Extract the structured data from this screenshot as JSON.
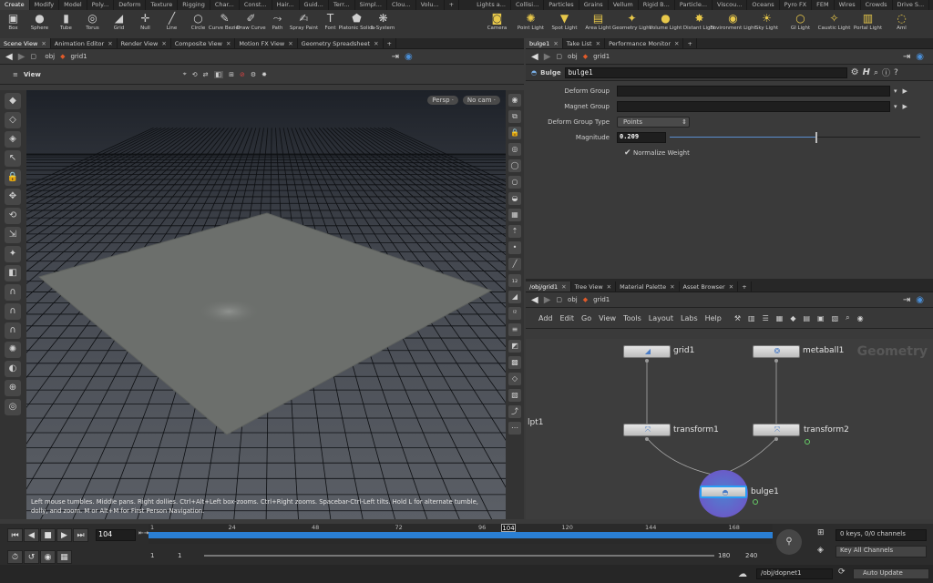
{
  "shelf": {
    "tabs_left": [
      "Create",
      "Modify",
      "Model",
      "Poly...",
      "Deform",
      "Texture",
      "Rigging",
      "Char...",
      "Const...",
      "Hair...",
      "Guid...",
      "Terr...",
      "Simpl...",
      "Clou...",
      "Volu..."
    ],
    "tabs_right": [
      "Lights a...",
      "Collisi...",
      "Particles",
      "Grains",
      "Vellum",
      "Rigid B...",
      "Particle...",
      "Viscou...",
      "Oceans",
      "Pyro FX",
      "FEM",
      "Wires",
      "Crowds",
      "Drive S..."
    ],
    "tools_left": [
      {
        "icon": "box-icon",
        "glyph": "▣",
        "label": "Box"
      },
      {
        "icon": "sphere-icon",
        "glyph": "●",
        "label": "Sphere"
      },
      {
        "icon": "tube-icon",
        "glyph": "▮",
        "label": "Tube"
      },
      {
        "icon": "torus-icon",
        "glyph": "◎",
        "label": "Torus"
      },
      {
        "icon": "grid-icon",
        "glyph": "◢",
        "label": "Grid"
      },
      {
        "icon": "null-icon",
        "glyph": "✛",
        "label": "Null"
      },
      {
        "icon": "line-icon",
        "glyph": "╱",
        "label": "Line"
      },
      {
        "icon": "circle-icon",
        "glyph": "○",
        "label": "Circle"
      },
      {
        "icon": "curve-bezier-icon",
        "glyph": "✎",
        "label": "Curve Bezier"
      },
      {
        "icon": "draw-curve-icon",
        "glyph": "✐",
        "label": "Draw Curve"
      },
      {
        "icon": "path-icon",
        "glyph": "⤳",
        "label": "Path"
      },
      {
        "icon": "spray-paint-icon",
        "glyph": "✍",
        "label": "Spray Paint"
      },
      {
        "icon": "font-icon",
        "glyph": "T",
        "label": "Font"
      },
      {
        "icon": "platonic-solids-icon",
        "glyph": "⬟",
        "label": "Platonic Solids"
      },
      {
        "icon": "l-system-icon",
        "glyph": "❋",
        "label": "L-System"
      }
    ],
    "tools_right": [
      {
        "icon": "camera-icon",
        "glyph": "◙",
        "label": "Camera"
      },
      {
        "icon": "point-light-icon",
        "glyph": "✺",
        "label": "Point Light"
      },
      {
        "icon": "spot-light-icon",
        "glyph": "▼",
        "label": "Spot Light"
      },
      {
        "icon": "area-light-icon",
        "glyph": "▤",
        "label": "Area Light"
      },
      {
        "icon": "geometry-light-icon",
        "glyph": "✦",
        "label": "Geometry Light"
      },
      {
        "icon": "volume-light-icon",
        "glyph": "●",
        "label": "Volume Light"
      },
      {
        "icon": "distant-light-icon",
        "glyph": "✸",
        "label": "Distant Light"
      },
      {
        "icon": "environment-light-icon",
        "glyph": "◉",
        "label": "Environment Light"
      },
      {
        "icon": "sky-light-icon",
        "glyph": "☀",
        "label": "Sky Light"
      },
      {
        "icon": "gi-light-icon",
        "glyph": "○",
        "label": "GI Light"
      },
      {
        "icon": "caustic-light-icon",
        "glyph": "✧",
        "label": "Caustic Light"
      },
      {
        "icon": "portal-light-icon",
        "glyph": "▥",
        "label": "Portal Light"
      },
      {
        "icon": "ambient-light-icon",
        "glyph": "◌",
        "label": "Aml"
      }
    ]
  },
  "left_pane": {
    "tabs": [
      "Scene View",
      "Animation Editor",
      "Render View",
      "Composite View",
      "Motion FX View",
      "Geometry Spreadsheet"
    ],
    "path": [
      "obj",
      "grid1"
    ],
    "view_label": "View",
    "persp": "Persp ·",
    "cam": "No cam ·",
    "hint": "Left mouse tumbles. Middle pans. Right dollies. Ctrl+Alt+Left box-zooms. Ctrl+Right zooms. Spacebar-Ctrl-Left tilts. Hold L for alternate tumble, dolly, and zoom.    M or Alt+M for First Person Navigation."
  },
  "params_pane": {
    "tabs": [
      "bulge1",
      "Take List",
      "Performance Monitor"
    ],
    "path": [
      "obj",
      "grid1"
    ],
    "node_type": "Bulge",
    "node_name": "bulge1",
    "rows": [
      {
        "label": "Deform Group",
        "value": ""
      },
      {
        "label": "Magnet Group",
        "value": ""
      }
    ],
    "deform_group_type_label": "Deform Group Type",
    "deform_group_type_value": "Points",
    "magnitude_label": "Magnitude",
    "magnitude_value": "0.209",
    "magnitude_fraction": 0.58,
    "normalize_label": "Normalize Weight",
    "normalize_checked": true
  },
  "network_pane": {
    "tabs": [
      "/obj/grid1",
      "Tree View",
      "Material Palette",
      "Asset Browser"
    ],
    "path": [
      "obj",
      "grid1"
    ],
    "menu": [
      "Add",
      "Edit",
      "Go",
      "View",
      "Tools",
      "Layout",
      "Labs",
      "Help"
    ],
    "watermark": "Geometry",
    "side_label": "lpt1",
    "nodes": {
      "grid1": "grid1",
      "metaball1": "metaball1",
      "transform1": "transform1",
      "transform2": "transform2",
      "bulge1": "bulge1"
    }
  },
  "timeline": {
    "ticks": [
      "1",
      "24",
      "48",
      "72",
      "96",
      "120",
      "144",
      "168"
    ],
    "current_frame": "104",
    "frame_field": "104",
    "start": "1",
    "start2": "1",
    "end": "180",
    "end2": "240",
    "keys": "0 keys, 0/0 channels",
    "key_all": "Key All Channels"
  },
  "status": {
    "path": "/obj/dopnet1",
    "update": "Auto Update"
  },
  "colors": {
    "accent": "#2a7fd4",
    "node_selected": "#6a5cc8"
  }
}
